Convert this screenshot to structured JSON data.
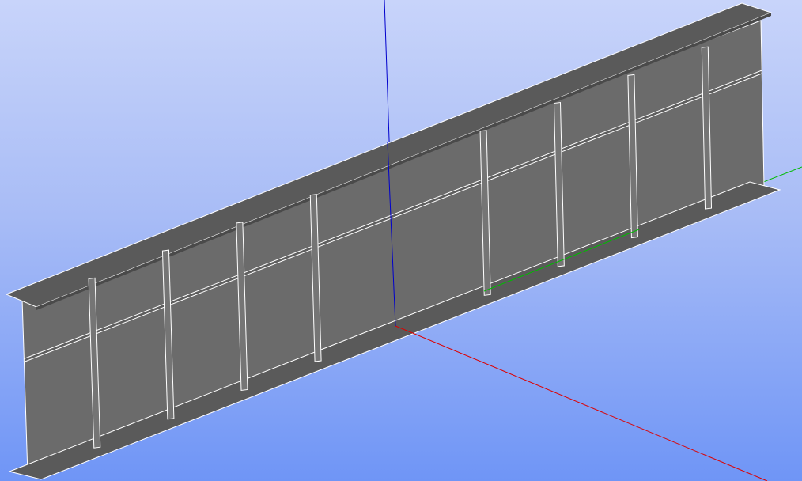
{
  "viewer": {
    "background_top": "#c8d4fa",
    "background_bottom": "#6f95f6"
  },
  "model": {
    "type": "plate-girder-with-stiffeners",
    "face_color": "#6b6b6b",
    "flange_color": "#5a5a5a",
    "edge_color": "#ffffff",
    "stiffener_count": 9,
    "has_longitudinal_stiffener": true
  },
  "axes": {
    "x": {
      "name": "x-axis",
      "color": "#dd0000"
    },
    "y": {
      "name": "y-axis",
      "color": "#00bb00"
    },
    "z": {
      "name": "z-axis",
      "color": "#0000cc"
    }
  }
}
